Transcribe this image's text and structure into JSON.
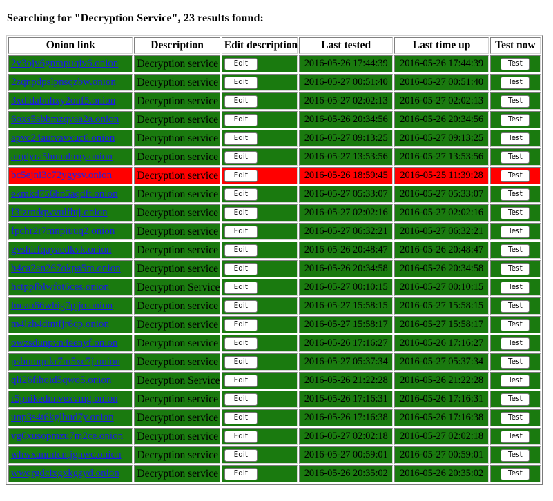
{
  "heading": "Searching for \"Decryption Service\", 23 results found:",
  "colors": {
    "up": "#1a7a0f",
    "down": "#ff0000",
    "link": "#1a1ae6",
    "page_background": "#ffffff"
  },
  "table": {
    "headers": {
      "onion_link": "Onion link",
      "description": "Description",
      "edit_description": "Edit description",
      "last_tested": "Last tested",
      "last_time_up": "Last time up",
      "test_now": "Test now"
    },
    "edit_button_label": "Edit",
    "test_button_label": "Test",
    "rows": [
      {
        "onion": "2v3ojv6gnmpuqiv6.onion",
        "description": "Decryption service",
        "last_tested": "2016-05-26 17:44:39",
        "last_time_up": "2016-05-26 17:44:39",
        "status": "up"
      },
      {
        "onion": "2zqnpdpslpnsqzbw.onion",
        "description": "Decryption service",
        "last_tested": "2016-05-27 00:51:40",
        "last_time_up": "2016-05-27 00:51:40",
        "status": "up"
      },
      {
        "onion": "3xdidabnhxy2onf5.onion",
        "description": "Decryption service",
        "last_tested": "2016-05-27 02:02:13",
        "last_time_up": "2016-05-27 02:02:13",
        "status": "up"
      },
      {
        "onion": "6oxs5abbmzqvaa2a.onion",
        "description": "Decryption service",
        "last_tested": "2016-05-26 20:34:56",
        "last_time_up": "2016-05-26 20:34:56",
        "status": "up"
      },
      {
        "onion": "apvc24autvavxuc6.onion",
        "description": "Decryption service",
        "last_tested": "2016-05-27 09:13:25",
        "last_time_up": "2016-05-27 09:13:25",
        "status": "up"
      },
      {
        "onion": "atqdyra5hnnuhrny.onion",
        "description": "Decryption service",
        "last_tested": "2016-05-27 13:53:56",
        "last_time_up": "2016-05-27 13:53:56",
        "status": "up"
      },
      {
        "onion": "bc5ejni3c72ygysv.onion",
        "description": "Decryption service",
        "last_tested": "2016-05-26 18:59:45",
        "last_time_up": "2016-05-25 11:39:28",
        "status": "down"
      },
      {
        "onion": "ekmkd756hn5aqdft.onion",
        "description": "Decryption service",
        "last_tested": "2016-05-27 05:33:07",
        "last_time_up": "2016-05-27 05:33:07",
        "status": "up"
      },
      {
        "onion": "f3izrndqwvulfhtj.onion",
        "description": "Decryption service",
        "last_tested": "2016-05-27 02:02:16",
        "last_time_up": "2016-05-27 02:02:16",
        "status": "up"
      },
      {
        "onion": "fpchr2r7mnpiuuq2.onion",
        "description": "Decryption service",
        "last_tested": "2016-05-27 06:32:21",
        "last_time_up": "2016-05-27 06:32:21",
        "status": "up"
      },
      {
        "onion": "gvshirfqayaedkvk.onion",
        "description": "Decryption service",
        "last_tested": "2016-05-26 20:48:47",
        "last_time_up": "2016-05-26 20:48:47",
        "status": "up"
      },
      {
        "onion": "h4ca2an267okpa5m.onion",
        "description": "Decryption service",
        "last_tested": "2016-05-26 20:34:58",
        "last_time_up": "2016-05-26 20:34:58",
        "status": "up"
      },
      {
        "onion": "hctppfblwfot6ces.onion",
        "description": "Decryption Service",
        "last_tested": "2016-05-27 00:10:15",
        "last_time_up": "2016-05-27 00:10:15",
        "status": "up"
      },
      {
        "onion": "lnuao66whig7pjjo.onion",
        "description": "Decryption service",
        "last_tested": "2016-05-27 15:58:15",
        "last_time_up": "2016-05-27 15:58:15",
        "status": "up"
      },
      {
        "onion": "m4lzh4dtntfjr6cp.onion",
        "description": "Decryption service",
        "last_tested": "2016-05-27 15:58:17",
        "last_time_up": "2016-05-27 15:58:17",
        "status": "up"
      },
      {
        "onion": "owzsdunpvn4eenyf.onion",
        "description": "Decryption service",
        "last_tested": "2016-05-26 17:16:27",
        "last_time_up": "2016-05-26 17:16:27",
        "status": "up"
      },
      {
        "onion": "psbomqukr7m5xc7j.onion",
        "description": "Decryption service",
        "last_tested": "2016-05-27 05:37:34",
        "last_time_up": "2016-05-27 05:37:34",
        "status": "up"
      },
      {
        "onion": "qli26fihoid5qwo5.onion",
        "description": "Decryption Service",
        "last_tested": "2016-05-26 21:22:28",
        "last_time_up": "2016-05-26 21:22:28",
        "status": "up"
      },
      {
        "onion": "r5pnikednnvexvmg.onion",
        "description": "Decryption service",
        "last_tested": "2016-05-26 17:16:31",
        "last_time_up": "2016-05-26 17:16:31",
        "status": "up"
      },
      {
        "onion": "unp3s4t6kglbud7y.onion",
        "description": "Decryption service",
        "last_tested": "2016-05-26 17:16:38",
        "last_time_up": "2016-05-26 17:16:38",
        "status": "up"
      },
      {
        "onion": "vg6xusopmzu7m2ce.onion",
        "description": "Decryption service",
        "last_tested": "2016-05-27 02:02:18",
        "last_time_up": "2016-05-27 02:02:18",
        "status": "up"
      },
      {
        "onion": "whwxanmtcntjgnwc.onion",
        "description": "Decryption service",
        "last_tested": "2016-05-27 00:59:01",
        "last_time_up": "2016-05-27 00:59:01",
        "status": "up"
      },
      {
        "onion": "wwqrgdcixgxkgzyd.onion",
        "description": "Decryption service",
        "last_tested": "2016-05-26 20:35:02",
        "last_time_up": "2016-05-26 20:35:02",
        "status": "up"
      }
    ]
  }
}
